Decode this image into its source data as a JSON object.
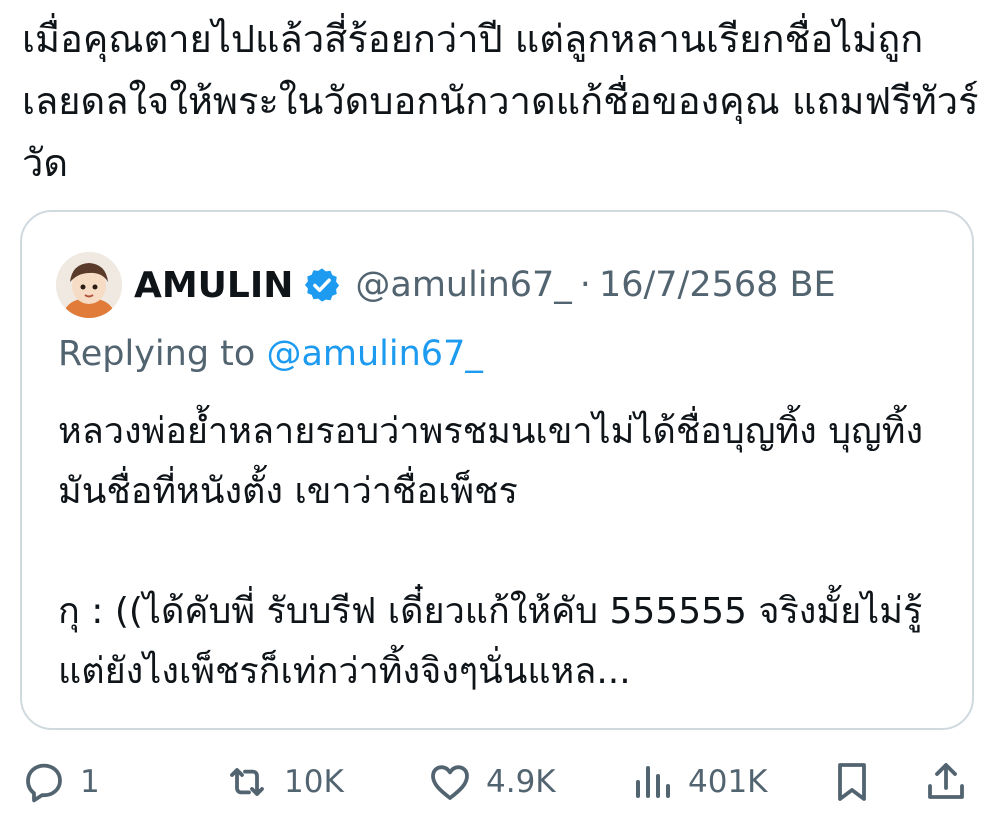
{
  "tweet": {
    "text": "เมื่อคุณตายไปแล้วสี่ร้อยกว่าปี แต่ลูกหลานเรียกชื่อไม่ถูก เลยดลใจให้พระในวัดบอกนักวาดแก้ชื่อของคุณ แถมฟรีทัวร์วัด"
  },
  "quote": {
    "display_name": "AMULIN",
    "handle": "@amulin67_",
    "separator": "·",
    "date": "16/7/2568 BE",
    "replying_prefix": "Replying to ",
    "replying_handle": "@amulin67_",
    "text": "หลวงพ่อย้ำหลายรอบว่าพรชมนเขาไม่ได้ชื่อบุญทิ้ง บุญทิ้งมันชื่อที่หนังตั้ง เขาว่าชื่อเพ็ชร\n\nกุ : ((ได้คับพี่ รับบรีฟ เดี๋ยวแก้ให้คับ 555555 จริงมั้ยไม่รู้แต่ยังไงเพ็ชรก็เท่กว่าทิ้งจิงๆนั่นแหล...",
    "verified_icon": "verified-badge-icon",
    "verified_color": "#1d9bf0"
  },
  "actions": {
    "reply": {
      "icon": "reply-icon",
      "count": "1"
    },
    "retweet": {
      "icon": "retweet-icon",
      "count": "10K"
    },
    "like": {
      "icon": "heart-icon",
      "count": "4.9K"
    },
    "views": {
      "icon": "views-icon",
      "count": "401K"
    },
    "bookmark": {
      "icon": "bookmark-icon"
    },
    "share": {
      "icon": "share-icon"
    }
  },
  "colors": {
    "text": "#0f1419",
    "secondary": "#536471",
    "accent": "#1d9bf0",
    "border": "#cfd9de"
  }
}
